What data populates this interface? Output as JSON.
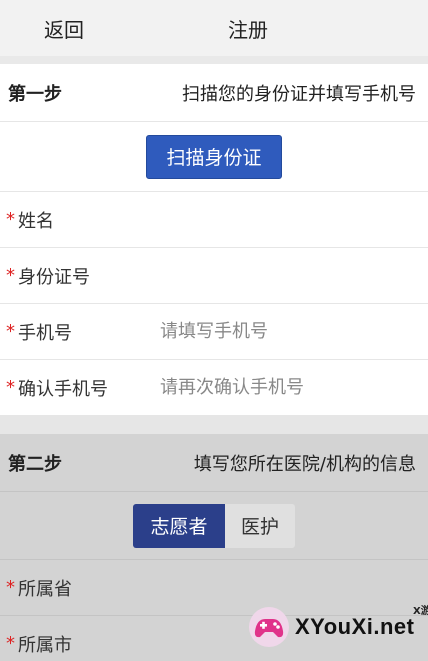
{
  "header": {
    "back_label": "返回",
    "title": "注册"
  },
  "step1": {
    "step_label": "第一步",
    "description": "扫描您的身份证并填写手机号",
    "scan_button": "扫描身份证",
    "fields": [
      {
        "required_mark": "*",
        "label": "姓名",
        "placeholder": ""
      },
      {
        "required_mark": "*",
        "label": "身份证号",
        "placeholder": ""
      },
      {
        "required_mark": "*",
        "label": "手机号",
        "placeholder": "请填写手机号"
      },
      {
        "required_mark": "*",
        "label": "确认手机号",
        "placeholder": "请再次确认手机号"
      }
    ]
  },
  "step2": {
    "step_label": "第二步",
    "description": "填写您所在医院/机构的信息",
    "toggle": {
      "option_a": "志愿者",
      "option_b": "医护",
      "selected": "志愿者"
    },
    "fields": [
      {
        "required_mark": "*",
        "label": "所属省"
      },
      {
        "required_mark": "*",
        "label": "所属市"
      }
    ]
  },
  "watermark": {
    "small_text": "X游戏",
    "big_text": "XYouXi.net"
  },
  "colors": {
    "primary_button": "#2f5bbd",
    "toggle_active": "#2b3f8a",
    "required": "#dd2222",
    "overlay_gray": "#d3d3d3"
  }
}
